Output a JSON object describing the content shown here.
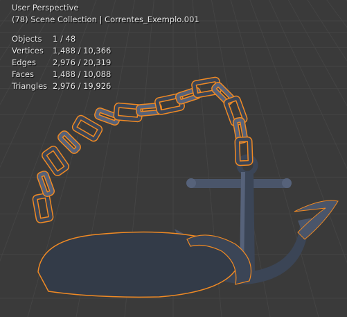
{
  "viewport": {
    "title": "User Perspective",
    "subtitle": "(78) Scene Collection | Correntes_Exemplo.001"
  },
  "stats": [
    {
      "label": "Objects",
      "value": "1 / 48"
    },
    {
      "label": "Vertices",
      "value": "1,488 / 10,366"
    },
    {
      "label": "Edges",
      "value": "2,976 / 20,319"
    },
    {
      "label": "Faces",
      "value": "1,488 / 10,088"
    },
    {
      "label": "Triangles",
      "value": "2,976 / 19,926"
    }
  ],
  "colors": {
    "background": "#3a3a3a",
    "grid": "#444444",
    "mesh": "#3b4556",
    "mesh_highlight": "#56627a",
    "selection_outline": "#f08a24"
  }
}
